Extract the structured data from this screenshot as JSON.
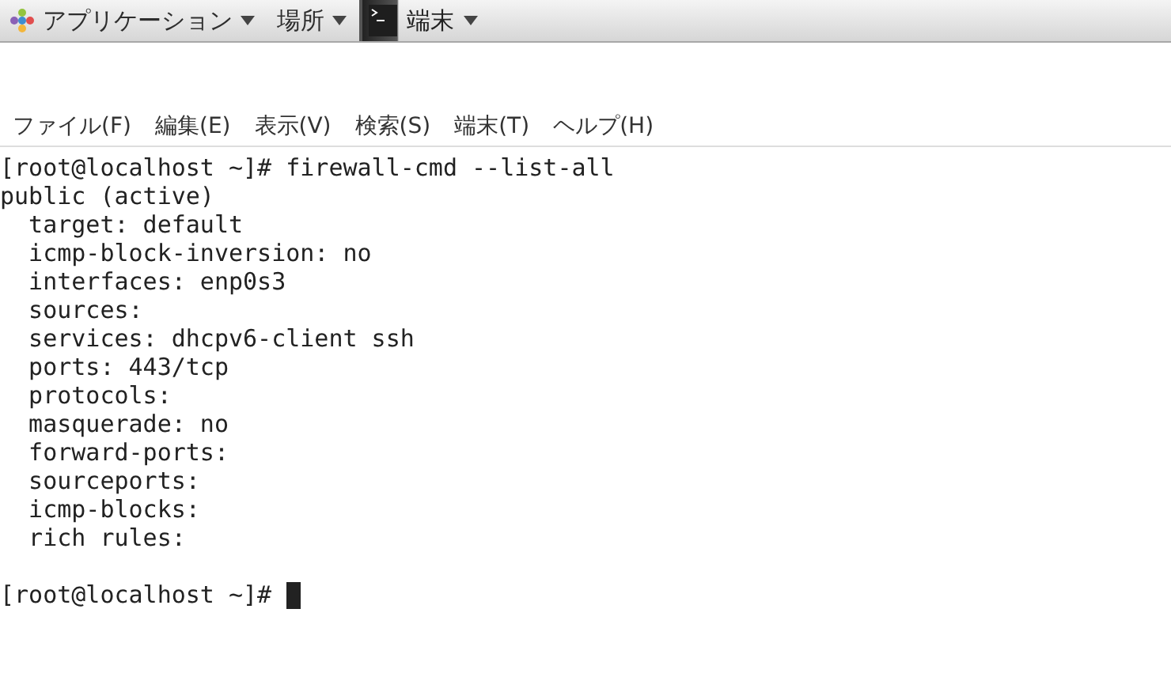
{
  "top_panel": {
    "menus": [
      {
        "label": "アプリケーション",
        "kind": "apps"
      },
      {
        "label": "場所",
        "kind": "plain"
      }
    ],
    "task": {
      "label": "端末",
      "selected": true
    }
  },
  "menu_bar": [
    "ファイル(F)",
    "編集(E)",
    "表示(V)",
    "検索(S)",
    "端末(T)",
    "ヘルプ(H)"
  ],
  "terminal": {
    "lines": [
      "[root@localhost ~]# firewall-cmd --list-all",
      "public (active)",
      "  target: default",
      "  icmp-block-inversion: no",
      "  interfaces: enp0s3",
      "  sources:",
      "  services: dhcpv6-client ssh",
      "  ports: 443/tcp",
      "  protocols:",
      "  masquerade: no",
      "  forward-ports:",
      "  sourceports:",
      "  icmp-blocks:",
      "  rich rules:"
    ],
    "prompt": "[root@localhost ~]#",
    "cursor": true
  }
}
